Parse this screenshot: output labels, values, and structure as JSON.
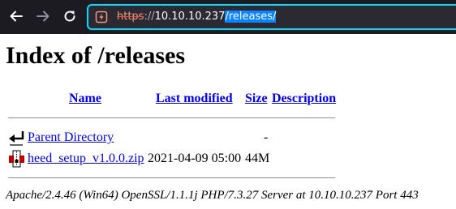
{
  "browser": {
    "url_scheme": "https",
    "url_separator": "://",
    "url_host": "10.10.10.237",
    "url_path": "/releases/"
  },
  "page": {
    "title": "Index of /releases",
    "columns": {
      "name": "Name",
      "last_modified": "Last modified",
      "size": "Size",
      "description": "Description"
    },
    "rows": [
      {
        "name": "Parent Directory",
        "last_modified": "",
        "size": "-",
        "description": "",
        "icon": "parent-directory-icon"
      },
      {
        "name": "heed_setup_v1.0.0.zip",
        "last_modified": "2021-04-09 05:00",
        "size": "44M",
        "description": "",
        "icon": "compressed-file-icon"
      }
    ],
    "footer": "Apache/2.4.46 (Win64) OpenSSL/1.1.1j PHP/7.3.27 Server at 10.10.10.237 Port 443"
  },
  "colors": {
    "toolbar_bg": "#1c1b22",
    "urlbar_bg": "#2b2a33",
    "urlbar_focus_ring": "#00ddff",
    "insecure_scheme": "#f49a80",
    "link": "#0000ee",
    "selection": "#0a84ff"
  }
}
